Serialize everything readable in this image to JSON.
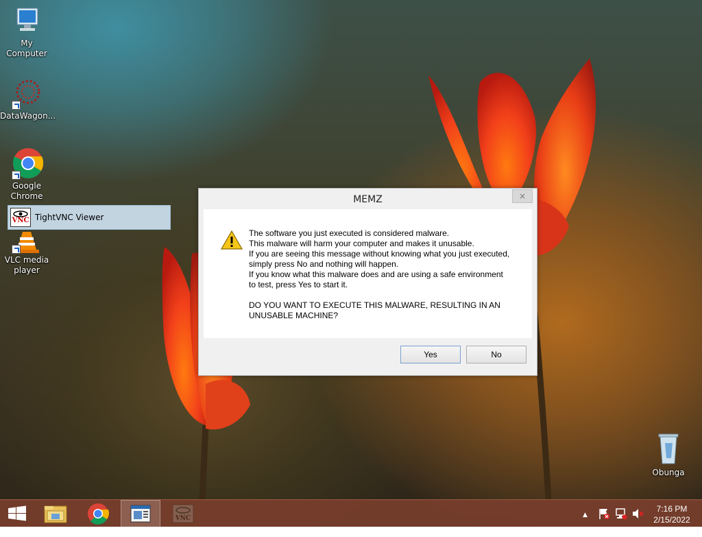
{
  "desktop": {
    "icons": [
      {
        "label": "My Computer"
      },
      {
        "label": "DataWagon..."
      },
      {
        "label": "Google Chrome"
      },
      {
        "label": "TightVNC Viewer"
      },
      {
        "label": "VLC media player"
      },
      {
        "label": "Obunga"
      }
    ]
  },
  "dialog": {
    "title": "MEMZ",
    "close_glyph": "×",
    "lines": [
      "The software you just executed is considered malware.",
      "This malware will harm your computer and makes it unusable.",
      "If you are seeing this message without knowing what you just executed,",
      "simply press No and nothing will happen.",
      "If you know what this malware does and are using a safe environment",
      "to test, press Yes to start it."
    ],
    "question_lines": [
      "DO YOU WANT TO EXECUTE THIS MALWARE, RESULTING IN AN",
      "UNUSABLE MACHINE?"
    ],
    "yes_label": "Yes",
    "no_label": "No",
    "icon": "warning-icon"
  },
  "taskbar": {
    "clock_time": "7:16 PM",
    "clock_date": "2/15/2022",
    "tray_chevron": "▲",
    "items": [
      "start-icon",
      "file-explorer-icon",
      "chrome-icon",
      "memz-window-icon",
      "tightvnc-icon"
    ]
  },
  "colors": {
    "taskbar": "#7a3e2c",
    "dialog_bg": "#f0f0f0",
    "highlight": "#cde1f0"
  }
}
